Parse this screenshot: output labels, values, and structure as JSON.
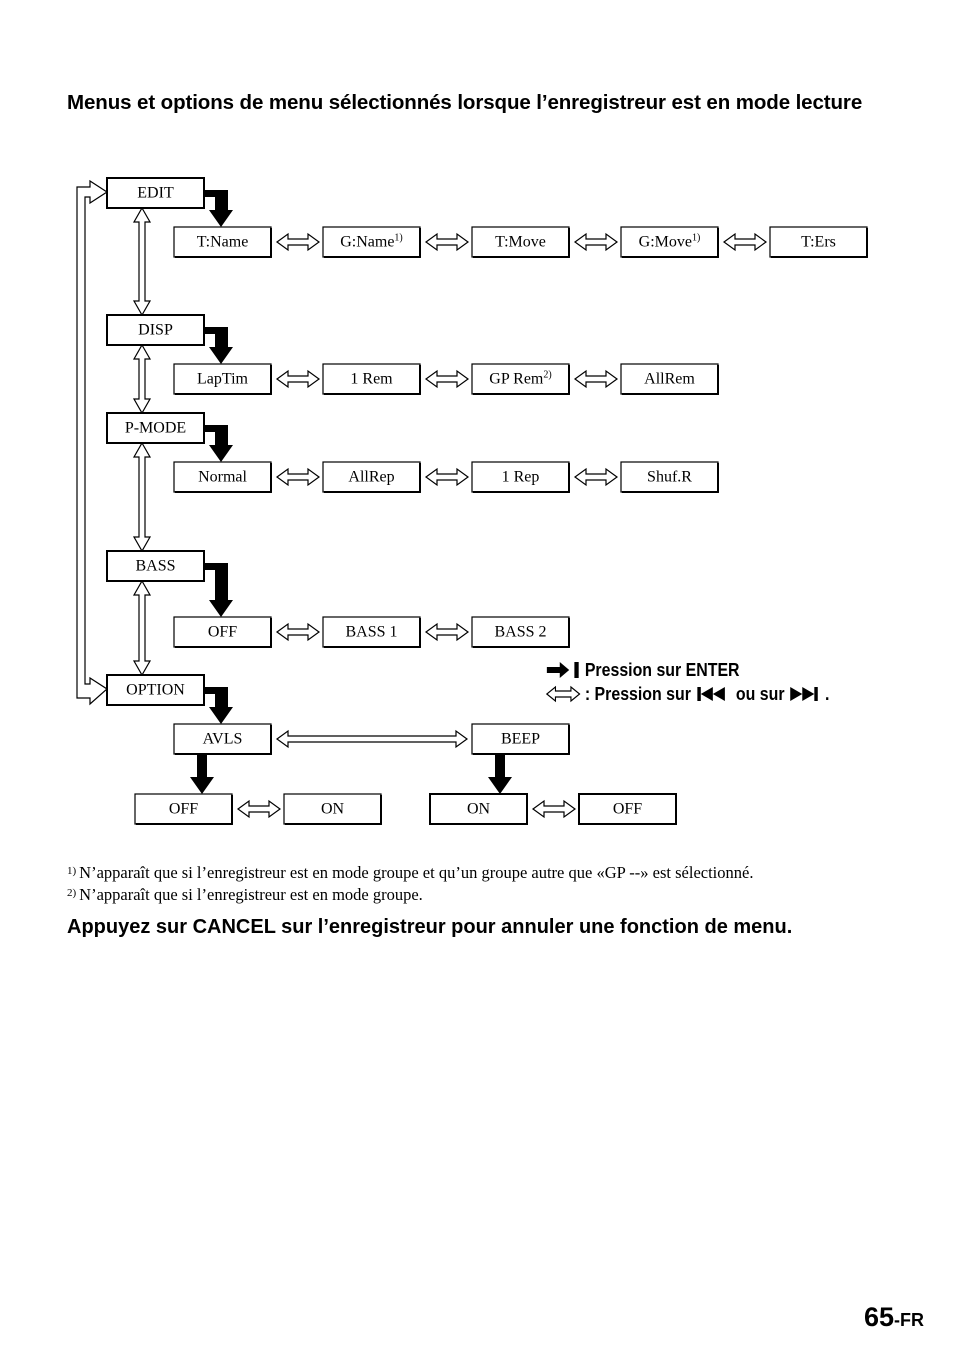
{
  "heading": "Menus et options de menu sélectionnés lorsque l’enregistreur est en mode lecture",
  "menu": {
    "main_items": [
      {
        "id": "edit",
        "label": "EDIT"
      },
      {
        "id": "disp",
        "label": "DISP"
      },
      {
        "id": "pmode",
        "label": "P-MODE"
      },
      {
        "id": "bass",
        "label": "BASS"
      },
      {
        "id": "option",
        "label": "OPTION"
      }
    ],
    "rows": {
      "edit": [
        {
          "label": "T:Name",
          "sup": ""
        },
        {
          "label": "G:Name",
          "sup": "1)"
        },
        {
          "label": "T:Move",
          "sup": ""
        },
        {
          "label": "G:Move",
          "sup": "1)"
        },
        {
          "label": "T:Ers",
          "sup": ""
        }
      ],
      "disp": [
        {
          "label": "LapTim",
          "sup": ""
        },
        {
          "label": "1 Rem",
          "sup": ""
        },
        {
          "label": "GP Rem",
          "sup": "2)"
        },
        {
          "label": "AllRem",
          "sup": ""
        }
      ],
      "pmode": [
        {
          "label": "Normal",
          "sup": ""
        },
        {
          "label": "AllRep",
          "sup": ""
        },
        {
          "label": "1 Rep",
          "sup": ""
        },
        {
          "label": "Shuf.R",
          "sup": ""
        }
      ],
      "bass": [
        {
          "label": "OFF",
          "sup": ""
        },
        {
          "label": "BASS 1",
          "sup": ""
        },
        {
          "label": "BASS 2",
          "sup": ""
        }
      ],
      "option": [
        {
          "label": "AVLS",
          "sup": ""
        },
        {
          "label": "BEEP",
          "sup": ""
        }
      ],
      "avls": [
        {
          "label": "OFF",
          "sup": ""
        },
        {
          "label": "ON",
          "sup": ""
        }
      ],
      "beep": [
        {
          "label": "ON",
          "sup": ""
        },
        {
          "label": "OFF",
          "sup": ""
        }
      ]
    }
  },
  "legend": {
    "enter": "Pression sur ENTER",
    "skip_prefix": ": Pression sur",
    "skip_middle": "ou sur",
    "skip_suffix": ".",
    "enter_icon": "enter-arrow-icon",
    "double_arrow_icon": "double-arrow-icon",
    "prev_icon": "skip-previous-icon",
    "next_icon": "skip-next-icon"
  },
  "footnotes": [
    {
      "mark": "1)",
      "text": "N’apparaît que si l’enregistreur est en mode groupe et qu’un groupe autre que «GP --» est sélectionné."
    },
    {
      "mark": "2)",
      "text": "N’apparaît que si l’enregistreur est en mode groupe."
    }
  ],
  "cancel_note": "Appuyez sur CANCEL sur l’enregistreur pour annuler une fonction de menu.",
  "page": {
    "number": "65",
    "suffix": "-FR"
  }
}
